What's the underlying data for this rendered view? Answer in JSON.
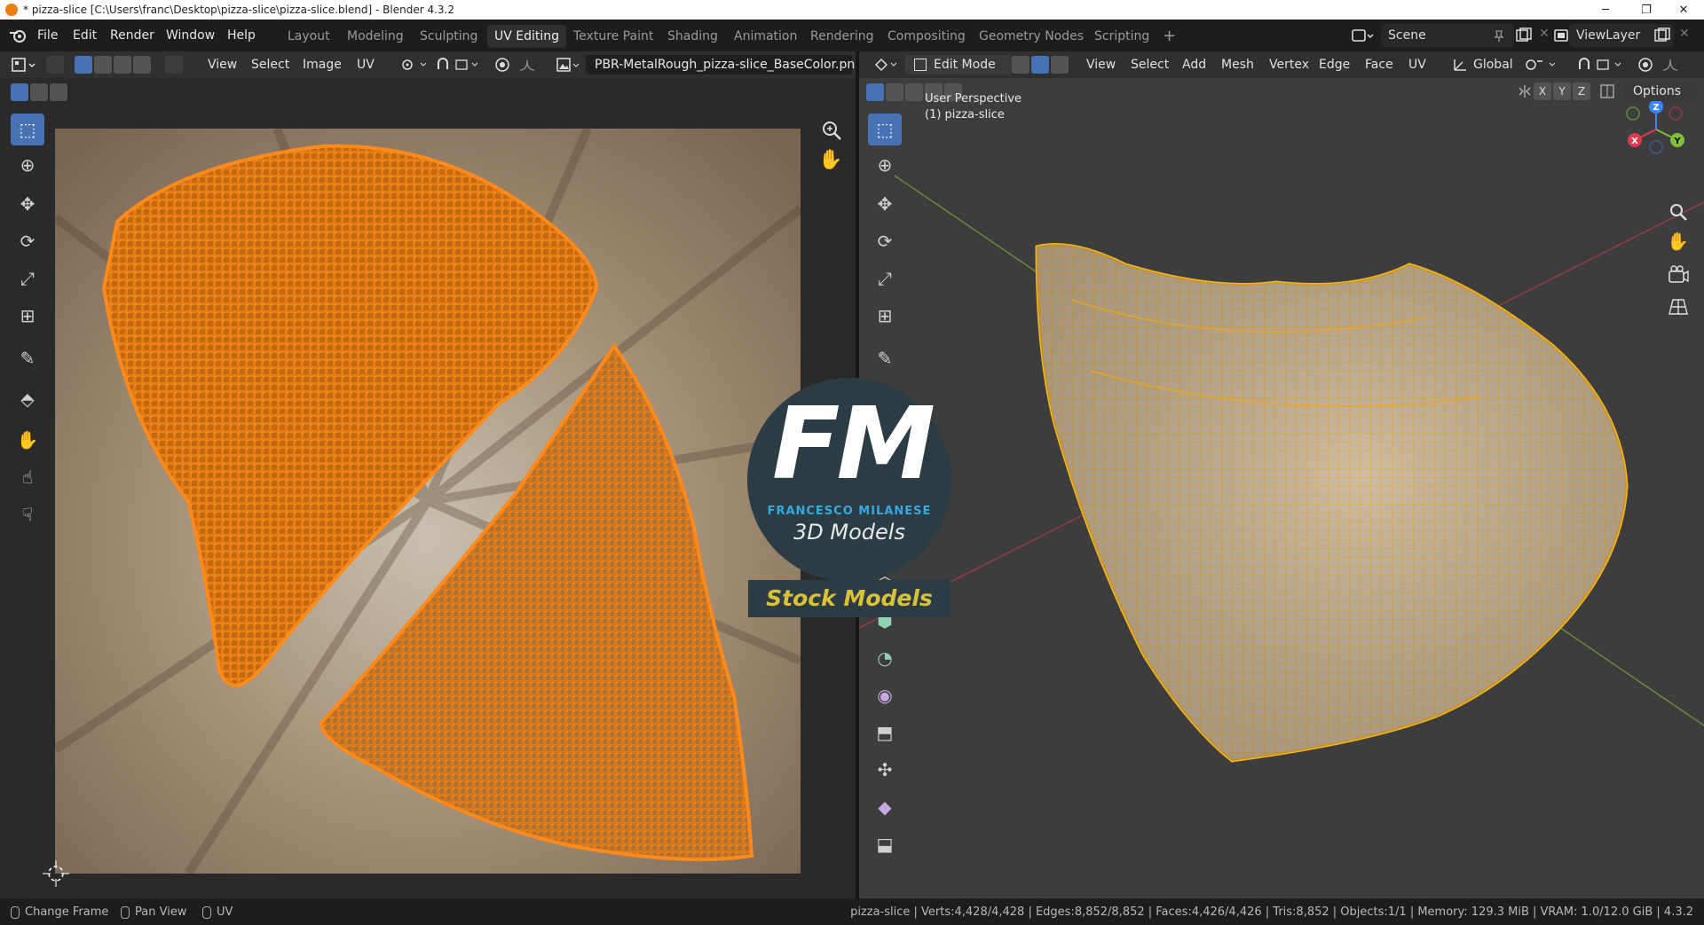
{
  "window": {
    "title": "* pizza-slice [C:\\Users\\franc\\Desktop\\pizza-slice\\pizza-slice.blend] - Blender 4.3.2",
    "min": "─",
    "max": "❐",
    "close": "✕"
  },
  "menu": [
    "File",
    "Edit",
    "Render",
    "Window",
    "Help"
  ],
  "workspaces": [
    "Layout",
    "Modeling",
    "Sculpting",
    "UV Editing",
    "Texture Paint",
    "Shading",
    "Animation",
    "Rendering",
    "Compositing",
    "Geometry Nodes",
    "Scripting"
  ],
  "active_workspace": "UV Editing",
  "add_workspace": "+",
  "scene": {
    "label": "Scene"
  },
  "view_layer": {
    "label": "ViewLayer"
  },
  "uv_editor": {
    "menus": [
      "View",
      "Select",
      "Image",
      "UV"
    ],
    "image_name": "PBR-MetalRough_pizza-slice_BaseColor.png"
  },
  "viewport": {
    "mode": "Edit Mode",
    "menus": [
      "View",
      "Select",
      "Add",
      "Mesh",
      "Vertex",
      "Edge",
      "Face",
      "UV"
    ],
    "orientation": "Global",
    "axes": [
      "X",
      "Y",
      "Z"
    ],
    "options": "Options",
    "overlay_line1": "User Perspective",
    "overlay_line2": "(1) pizza-slice",
    "gizmo": {
      "x": "X",
      "y": "Y",
      "z": "Z"
    }
  },
  "watermark": {
    "logo_text": "FM",
    "name": "FRANCESCO MILANESE",
    "tagline": "3D Models",
    "banner": "Stock Models"
  },
  "status": {
    "hint1": "Change Frame",
    "hint2": "Pan View",
    "hint3": "UV",
    "stats": "pizza-slice | Verts:4,428/4,428 | Edges:8,852/8,852 | Faces:4,426/4,426 | Tris:8,852 | Objects:1/1 | Memory: 129.3 MiB | VRAM: 1.0/12.0 GiB | 4.3.2"
  },
  "colors": {
    "accent": "#4772b3",
    "selected_uv": "#ff8a1c",
    "wireframe": "#f2b422",
    "mesh_surface": "#c9b49b"
  }
}
